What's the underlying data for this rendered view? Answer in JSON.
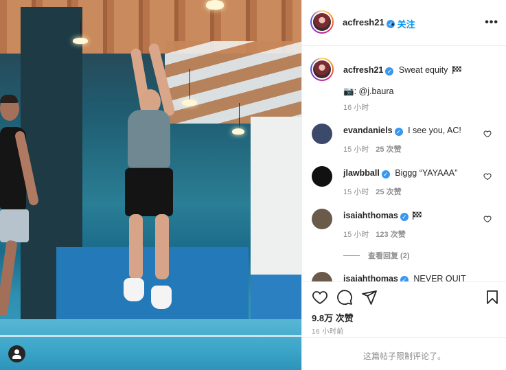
{
  "post": {
    "author": "acfresh21",
    "follow_label": "关注",
    "more_label": "•••",
    "caption_text": "Sweat equity",
    "caption_credit": "@j.baura",
    "caption_camera": "📷:",
    "caption_time": "16 小时"
  },
  "comments": [
    {
      "user": "evandaniels",
      "text": "I see you, AC!",
      "time": "15 小时",
      "likes": "25 次赞",
      "avatar_color": "#3b4a6b"
    },
    {
      "user": "jlawbball",
      "text": "Biggg “YAYAAA”",
      "time": "15 小时",
      "likes": "25 次赞",
      "avatar_color": "#111111"
    },
    {
      "user": "isaiahthomas",
      "text": "",
      "time": "15 小时",
      "likes": "123 次赞",
      "avatar_color": "#6a5a4a",
      "view_replies": "查看回复 (2)"
    },
    {
      "user": "isaiahthomas",
      "text": "NEVER QUIT",
      "avatar_color": "#6a5a4a"
    }
  ],
  "stats": {
    "likes": "9.8万 次赞",
    "time_ago": "16 小时前"
  },
  "footer": {
    "comments_limited": "这篇帖子限制评论了。"
  },
  "icons": {
    "like": "heart-icon",
    "comment": "comment-icon",
    "share": "share-icon",
    "save": "bookmark-icon"
  },
  "colors": {
    "link_blue": "#0095f6",
    "verified_blue": "#3897f0",
    "muted_text": "#8e8e8e",
    "text": "#262626"
  }
}
